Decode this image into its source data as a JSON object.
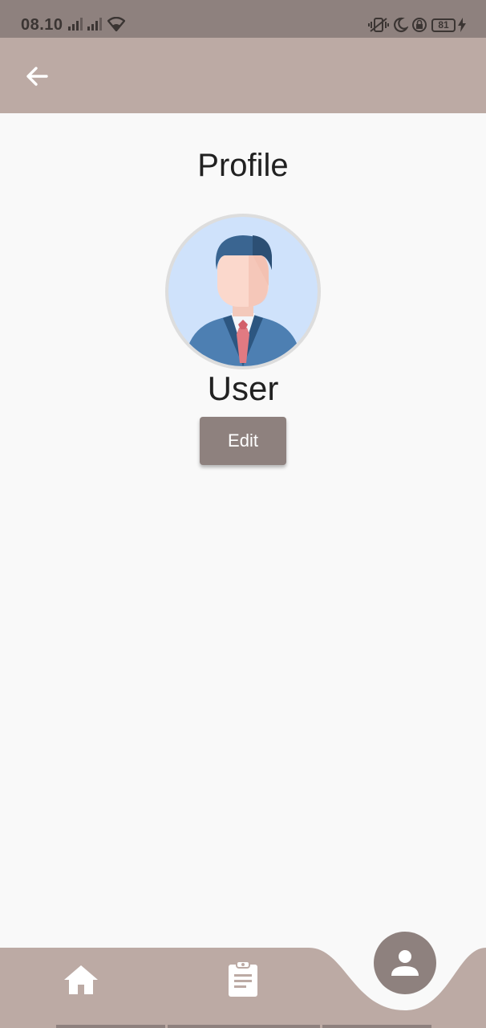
{
  "status_bar": {
    "time": "08.10",
    "battery": "81",
    "icons": [
      "signal-icon",
      "signal-icon",
      "wifi-icon",
      "vibrate-icon",
      "moon-icon",
      "lock-rotation-icon",
      "battery-icon",
      "charging-icon"
    ]
  },
  "app_bar": {
    "back_icon": "arrow-left-icon"
  },
  "profile": {
    "title": "Profile",
    "user_name": "User",
    "edit_label": "Edit"
  },
  "bottom_nav": {
    "items": [
      {
        "icon": "home-icon",
        "active": false
      },
      {
        "icon": "clipboard-icon",
        "active": false
      },
      {
        "icon": "person-icon",
        "active": true
      }
    ]
  },
  "colors": {
    "status_bar": "#8e817e",
    "app_bar": "#bcaaa4",
    "accent": "#8e817e",
    "background": "#f9f9f9"
  }
}
